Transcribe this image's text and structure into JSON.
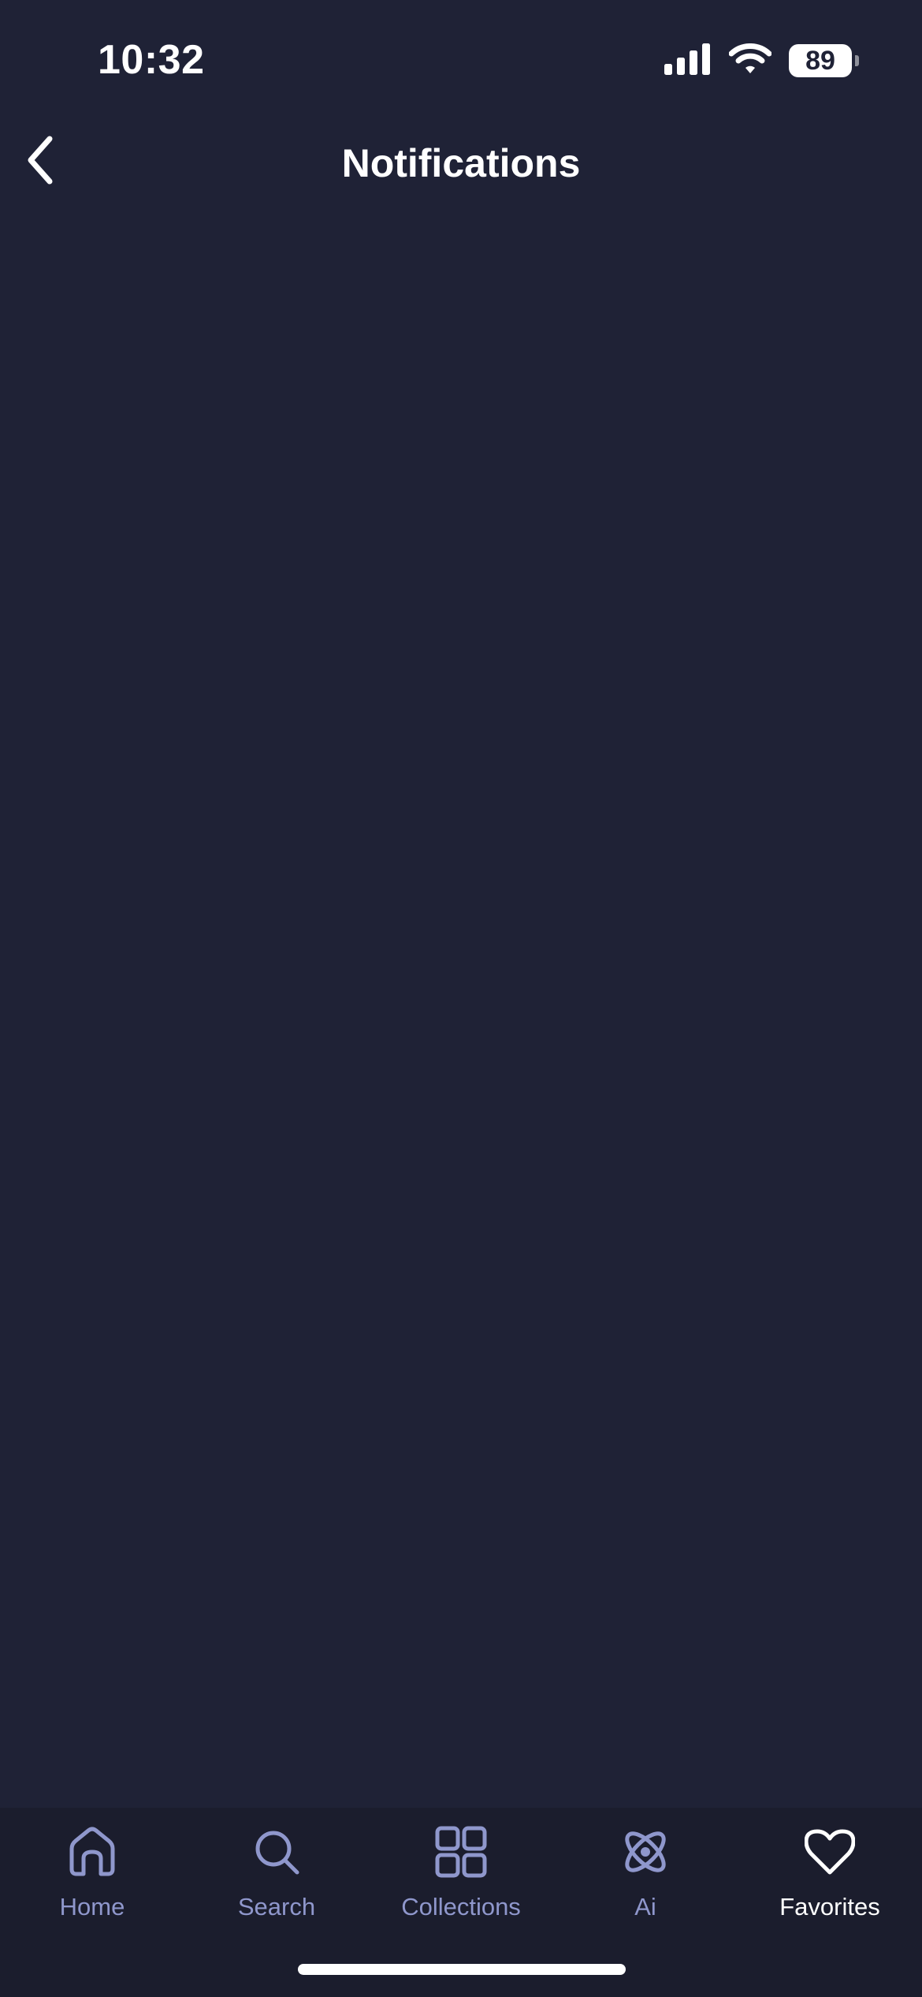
{
  "status_bar": {
    "time": "10:32",
    "battery": "89",
    "icons": [
      "signal-icon",
      "wifi-icon",
      "battery-icon"
    ]
  },
  "header": {
    "title": "Notifications",
    "back_icon": "chevron-left-icon"
  },
  "tab_bar": {
    "tabs": [
      {
        "label": "Home",
        "icon": "home-icon",
        "active": false
      },
      {
        "label": "Search",
        "icon": "search-icon",
        "active": false
      },
      {
        "label": "Collections",
        "icon": "grid-icon",
        "active": false
      },
      {
        "label": "Ai",
        "icon": "atom-icon",
        "active": false
      },
      {
        "label": "Favorites",
        "icon": "heart-icon",
        "active": true
      }
    ]
  },
  "colors": {
    "background": "#1f2236",
    "tab_bar_background": "#1b1d2d",
    "inactive_tab": "#8f97cc",
    "active_tab": "#ffffff",
    "text": "#ffffff"
  }
}
